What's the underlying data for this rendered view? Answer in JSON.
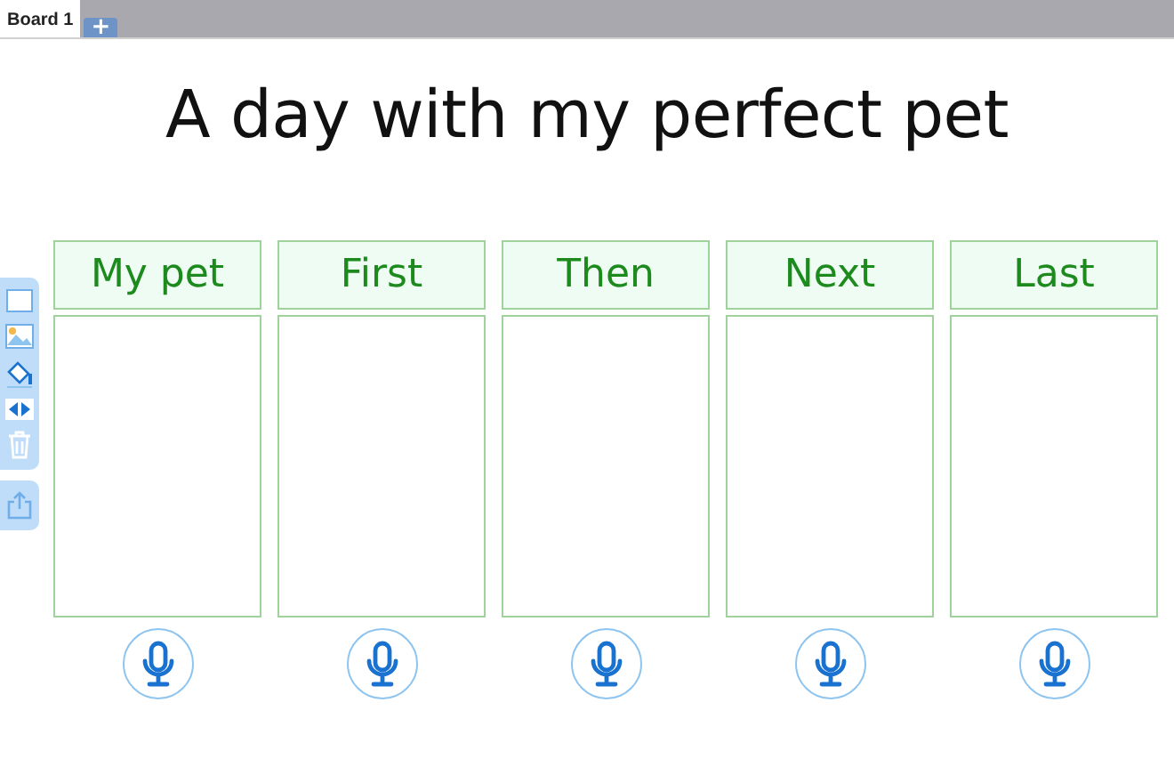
{
  "tabs": [
    {
      "label": "Board 1",
      "selected": true
    }
  ],
  "add_tab": "+",
  "title": "A day with my perfect pet",
  "columns": [
    {
      "heading": "My pet"
    },
    {
      "heading": "First"
    },
    {
      "heading": "Then"
    },
    {
      "heading": "Next"
    },
    {
      "heading": "Last"
    }
  ]
}
